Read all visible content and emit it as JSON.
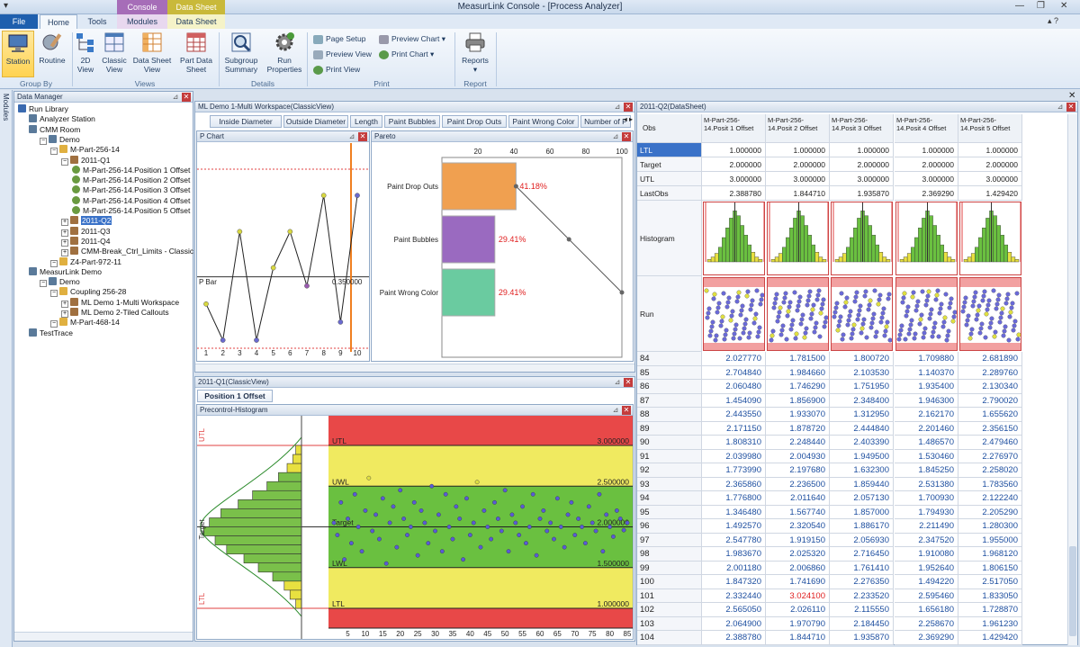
{
  "window": {
    "title": "MeasurLink Console - [Process Analyzer]"
  },
  "context_tabs": {
    "console": "Console",
    "data_sheet": "Data Sheet"
  },
  "ribbon_tabs": [
    "File",
    "Home",
    "Tools",
    "Modules",
    "Data Sheet"
  ],
  "ribbon": {
    "group_by": {
      "label": "Group By",
      "station": "Station",
      "routine": "Routine"
    },
    "views": {
      "label": "Views",
      "v2d": "2D View",
      "classic": "Classic View",
      "datasheet": "Data Sheet View",
      "partdata": "Part Data Sheet"
    },
    "details": {
      "label": "Details",
      "subgroup": "Subgroup Summary",
      "run": "Run Properties"
    },
    "print": {
      "label": "Print",
      "page_setup": "Page Setup",
      "preview": "Preview View",
      "print_view": "Print View",
      "preview_chart": "Preview Chart",
      "print_chart": "Print Chart"
    },
    "report": {
      "label": "Report",
      "reports": "Reports"
    }
  },
  "side_tab": "Modules",
  "data_manager": {
    "title": "Data Manager",
    "tree": [
      {
        "label": "Run Library",
        "level": 0
      },
      {
        "label": "Analyzer Station",
        "level": 1
      },
      {
        "label": "CMM Room",
        "level": 1
      },
      {
        "label": "Demo",
        "level": 2
      },
      {
        "label": "M-Part-256-14",
        "level": 3
      },
      {
        "label": "2011-Q1",
        "level": 4
      },
      {
        "label": "M-Part-256-14.Position 1 Offset",
        "level": 5
      },
      {
        "label": "M-Part-256-14.Position 2 Offset",
        "level": 5
      },
      {
        "label": "M-Part-256-14.Position 3 Offset",
        "level": 5
      },
      {
        "label": "M-Part-256-14.Position 4 Offset",
        "level": 5
      },
      {
        "label": "M-Part-256-14.Position 5 Offset",
        "level": 5
      },
      {
        "label": "2011-Q2",
        "level": 4,
        "selected": true
      },
      {
        "label": "2011-Q3",
        "level": 4
      },
      {
        "label": "2011-Q4",
        "level": 4
      },
      {
        "label": "CMM-Break_Ctrl_Limits - Classic On",
        "level": 4
      },
      {
        "label": "Z4-Part-972-11",
        "level": 3
      },
      {
        "label": "MeasurLink Demo",
        "level": 1
      },
      {
        "label": "Demo",
        "level": 2
      },
      {
        "label": "Coupling 256-28",
        "level": 3
      },
      {
        "label": "ML Demo 1-Multi Workspace",
        "level": 4
      },
      {
        "label": "ML Demo 2-Tiled Callouts",
        "level": 4
      },
      {
        "label": "M-Part-468-14",
        "level": 3
      },
      {
        "label": "TestTrace",
        "level": 1
      }
    ]
  },
  "workspace": {
    "title": "ML Demo 1-Multi Workspace(ClassicView)",
    "tabs": [
      "Inside Diameter",
      "Outside Diameter",
      "Length",
      "Paint Bubbles",
      "Paint Drop Outs",
      "Paint Wrong Color",
      "Number of P"
    ]
  },
  "pchart": {
    "title": "P Chart",
    "pbar_label": "P Bar",
    "pbar_value": "0.350000",
    "x_ticks": [
      "1",
      "2",
      "3",
      "4",
      "5",
      "6",
      "7",
      "8",
      "9",
      "10"
    ],
    "points": [
      0.2,
      0.0,
      0.6,
      0.0,
      0.4,
      0.6,
      0.3,
      0.8,
      0.1,
      0.8
    ],
    "colors": [
      "#d8d840",
      "#6a6ad0",
      "#d8d840",
      "#6a6ad0",
      "#d8d840",
      "#d8d840",
      "#9a5ab0",
      "#d8d840",
      "#6a6ad0",
      "#6a6ad0"
    ]
  },
  "pareto": {
    "title": "Pareto",
    "x_ticks": [
      "20",
      "40",
      "60",
      "80",
      "100"
    ],
    "bars": [
      {
        "label": "Paint Drop Outs",
        "pct": "41.18%",
        "value": 41.18,
        "color": "#f0a050"
      },
      {
        "label": "Paint Bubbles",
        "pct": "29.41%",
        "value": 29.41,
        "color": "#9a6ac0"
      },
      {
        "label": "Paint Wrong Color",
        "pct": "29.41%",
        "value": 29.41,
        "color": "#6acba0"
      }
    ],
    "cumulative": [
      41.18,
      70.59,
      100
    ]
  },
  "q1_panel": {
    "title": "2011-Q1(ClassicView)",
    "tab": "Position 1 Offset",
    "precontrol_title": "Precontrol-Histogram",
    "hist_labels": {
      "utl": "UTL",
      "ltl": "LTL",
      "target": "Target"
    },
    "zones": {
      "utl": "UTL",
      "uwl": "UWL",
      "target": "Target",
      "lwl": "LWL",
      "ltl": "LTL"
    },
    "zone_values": {
      "utl": "3.000000",
      "uwl": "2.500000",
      "target": "2.000000",
      "lwl": "1.500000",
      "ltl": "1.000000"
    },
    "x_ticks": [
      "5",
      "10",
      "15",
      "20",
      "25",
      "30",
      "35",
      "40",
      "45",
      "50",
      "55",
      "60",
      "65",
      "70",
      "75",
      "80",
      "85"
    ]
  },
  "datasheet": {
    "title": "2011-Q2(DataSheet)",
    "obs_label": "Obs",
    "columns": [
      "M-Part-256-14.Posit 1 Offset",
      "M-Part-256-14.Posit 2 Offset",
      "M-Part-256-14.Posit 3 Offset",
      "M-Part-256-14.Posit 4 Offset",
      "M-Part-256-14.Posit 5 Offset"
    ],
    "spec_rows": [
      {
        "label": "LTL",
        "values": [
          "1.000000",
          "1.000000",
          "1.000000",
          "1.000000",
          "1.000000"
        ]
      },
      {
        "label": "Target",
        "values": [
          "2.000000",
          "2.000000",
          "2.000000",
          "2.000000",
          "2.000000"
        ]
      },
      {
        "label": "UTL",
        "values": [
          "3.000000",
          "3.000000",
          "3.000000",
          "3.000000",
          "3.000000"
        ]
      },
      {
        "label": "LastObs",
        "values": [
          "2.388780",
          "1.844710",
          "1.935870",
          "2.369290",
          "1.429420"
        ]
      }
    ],
    "histogram_label": "Histogram",
    "run_label": "Run",
    "rows": [
      {
        "obs": "84",
        "values": [
          "2.027770",
          "1.781500",
          "1.800720",
          "1.709880",
          "2.681890"
        ]
      },
      {
        "obs": "85",
        "values": [
          "2.704840",
          "1.984660",
          "2.103530",
          "1.140370",
          "2.289760"
        ]
      },
      {
        "obs": "86",
        "values": [
          "2.060480",
          "1.746290",
          "1.751950",
          "1.935400",
          "2.130340"
        ]
      },
      {
        "obs": "87",
        "values": [
          "1.454090",
          "1.856900",
          "2.348400",
          "1.946300",
          "2.790020"
        ]
      },
      {
        "obs": "88",
        "values": [
          "2.443550",
          "1.933070",
          "1.312950",
          "2.162170",
          "1.655620"
        ]
      },
      {
        "obs": "89",
        "values": [
          "2.171150",
          "1.878720",
          "2.444840",
          "2.201460",
          "2.356150"
        ]
      },
      {
        "obs": "90",
        "values": [
          "1.808310",
          "2.248440",
          "2.403390",
          "1.486570",
          "2.479460"
        ]
      },
      {
        "obs": "91",
        "values": [
          "2.039980",
          "2.004930",
          "1.949500",
          "1.530460",
          "2.276970"
        ]
      },
      {
        "obs": "92",
        "values": [
          "1.773990",
          "2.197680",
          "1.632300",
          "1.845250",
          "2.258020"
        ]
      },
      {
        "obs": "93",
        "values": [
          "2.365860",
          "2.236500",
          "1.859440",
          "2.531380",
          "1.783560"
        ]
      },
      {
        "obs": "94",
        "values": [
          "1.776800",
          "2.011640",
          "2.057130",
          "1.700930",
          "2.122240"
        ]
      },
      {
        "obs": "95",
        "values": [
          "1.346480",
          "1.567740",
          "1.857000",
          "1.794930",
          "2.205290"
        ]
      },
      {
        "obs": "96",
        "values": [
          "1.492570",
          "2.320540",
          "1.886170",
          "2.211490",
          "1.280300"
        ]
      },
      {
        "obs": "97",
        "values": [
          "2.547780",
          "1.919150",
          "2.056930",
          "2.347520",
          "1.955000"
        ]
      },
      {
        "obs": "98",
        "values": [
          "1.983670",
          "2.025320",
          "2.716450",
          "1.910080",
          "1.968120"
        ]
      },
      {
        "obs": "99",
        "values": [
          "2.001180",
          "2.006860",
          "1.761410",
          "1.952640",
          "1.806150"
        ]
      },
      {
        "obs": "100",
        "values": [
          "1.847320",
          "1.741690",
          "2.276350",
          "1.494220",
          "2.517050"
        ]
      },
      {
        "obs": "101",
        "values": [
          "2.332440",
          "3.024100",
          "2.233520",
          "2.595460",
          "1.833050"
        ]
      },
      {
        "obs": "102",
        "values": [
          "2.565050",
          "2.026110",
          "2.115550",
          "1.656180",
          "1.728870"
        ]
      },
      {
        "obs": "103",
        "values": [
          "2.064900",
          "1.970790",
          "2.184450",
          "2.258670",
          "1.961230"
        ]
      },
      {
        "obs": "104",
        "values": [
          "2.388780",
          "1.844710",
          "1.935870",
          "2.369290",
          "1.429420"
        ]
      }
    ],
    "out_of_spec_color": "#e02020",
    "value_color": "#1e4fa0"
  }
}
